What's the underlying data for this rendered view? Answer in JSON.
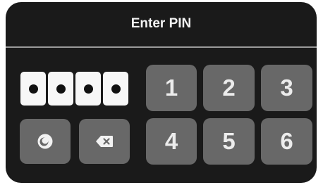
{
  "header": {
    "title": "Enter PIN"
  },
  "pin": {
    "entered_digits": 4
  },
  "keypad": {
    "keys": [
      "1",
      "2",
      "3",
      "4",
      "5",
      "6"
    ]
  },
  "controls": {
    "toggle_visibility_icon": "eye-icon",
    "backspace_icon": "backspace-icon"
  },
  "colors": {
    "panel_background": "#1a1a1a",
    "key_background": "#686868",
    "key_text": "#ececec",
    "pin_slot": "#f7f7f7",
    "divider": "#9a9a9a"
  }
}
